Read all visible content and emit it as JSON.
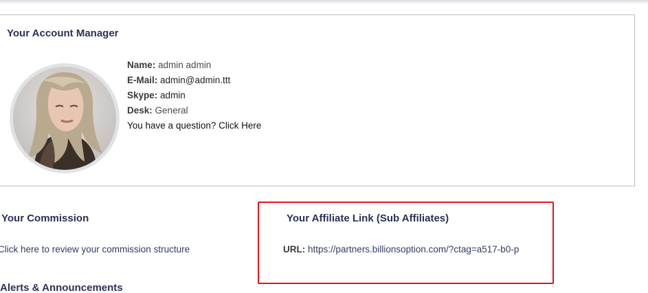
{
  "manager": {
    "title": "Your Account Manager",
    "avatar_alt": "account manager photo",
    "fields": [
      {
        "label": "Name:",
        "value": "admin admin"
      },
      {
        "label": "E-Mail:",
        "value": "admin@admin.ttt"
      },
      {
        "label": "Skype:",
        "value": "admin"
      },
      {
        "label": "Desk:",
        "value": "General"
      }
    ],
    "question_text": "You have a question? Click Here"
  },
  "commission": {
    "title": "Your Commission",
    "link_text": "Click here to review your commission structure"
  },
  "affiliate": {
    "title": "Your Affiliate Link (Sub Affiliates)",
    "url_label": "URL:",
    "url_value": "https://partners.billionsoption.com/?ctag=a517-b0-p"
  },
  "alerts": {
    "title": "Alerts & Announcements"
  },
  "colors": {
    "heading": "#2b3156",
    "link": "#2f3b63",
    "highlight": "#e3141c",
    "card_border": "#b9bcc6"
  }
}
